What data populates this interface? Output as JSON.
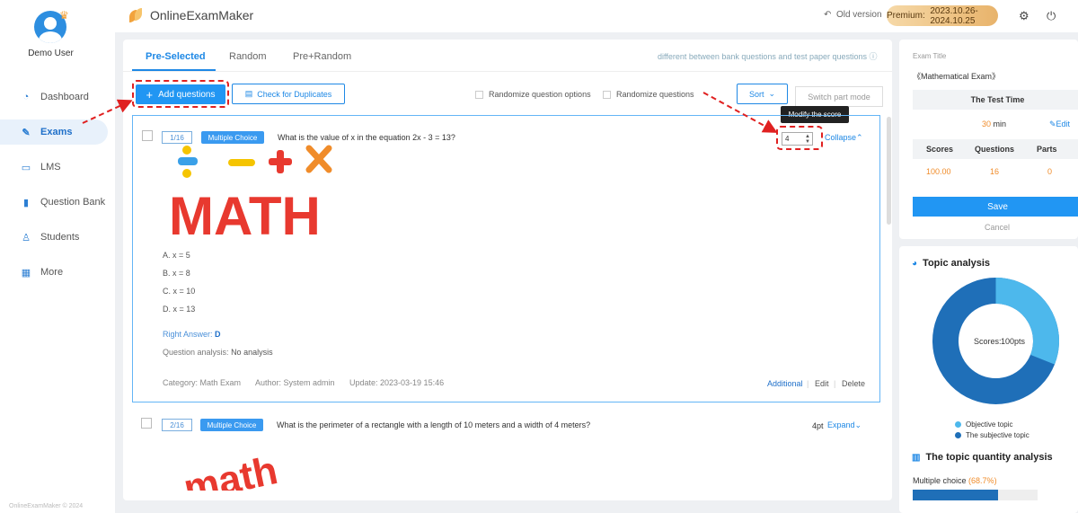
{
  "sidebar": {
    "username": "Demo User",
    "items": [
      {
        "label": "Dashboard",
        "icon": "dashboard-icon"
      },
      {
        "label": "Exams",
        "icon": "pencil-icon"
      },
      {
        "label": "LMS",
        "icon": "book-icon"
      },
      {
        "label": "Question Bank",
        "icon": "chart-bars-icon"
      },
      {
        "label": "Students",
        "icon": "person-icon"
      },
      {
        "label": "More",
        "icon": "grid-icon"
      }
    ],
    "copyright": "OnlineExamMaker © 2024"
  },
  "topbar": {
    "brand": "OnlineExamMaker",
    "old_version": "Old version",
    "premium_label": "Premium:",
    "premium_dates": "2023.10.26-2024.10.25"
  },
  "tabs": {
    "pre_selected": "Pre-Selected",
    "random": "Random",
    "pre_random": "Pre+Random",
    "note": "different between bank questions and test paper questions"
  },
  "toolbar": {
    "add_questions": "Add questions",
    "check_duplicates": "Check for Duplicates",
    "randomize_options": "Randomize question options",
    "randomize_questions": "Randomize questions",
    "sort": "Sort",
    "switch_part": "Switch part mode",
    "tooltip": "Modify the score"
  },
  "question1": {
    "number": "1/16",
    "type": "Multiple Choice",
    "text": "What is the value of x in the equation 2x - 3 = 13?",
    "score": "4",
    "collapse": "Collapse",
    "image_text": "MATH",
    "options": [
      "A. x = 5",
      "B. x = 8",
      "C. x = 10",
      "D. x = 13"
    ],
    "right_answer_label": "Right Answer:",
    "right_answer": "D",
    "analysis_label": "Question analysis:",
    "analysis": "No analysis",
    "category": "Category: Math Exam",
    "author": "Author: System admin",
    "update": "Update: 2023-03-19 15:46",
    "additional": "Additional",
    "edit": "Edit",
    "delete": "Delete"
  },
  "question2": {
    "number": "2/16",
    "type": "Multiple Choice",
    "text": "What is the perimeter of a rectangle with a length of 10 meters and a width of 4 meters?",
    "score": "4pt",
    "expand": "Expand",
    "image_text": "math"
  },
  "exam_info": {
    "title_label": "Exam Title",
    "title": "《Mathematical Exam》",
    "test_time_label": "The Test Time",
    "time_value": "30",
    "time_unit": "min",
    "edit": "Edit",
    "headers": [
      "Scores",
      "Questions",
      "Parts"
    ],
    "values": [
      "100.00",
      "16",
      "0"
    ],
    "save": "Save",
    "cancel": "Cancel"
  },
  "topic_analysis": {
    "title": "Topic analysis",
    "center_label": "Scores:",
    "center_value": "100pts",
    "legend": [
      "Objective topic",
      "The subjective topic"
    ],
    "colors": [
      "#4db8ec",
      "#1f6fb8"
    ],
    "objective_fraction": 0.31
  },
  "quantity_analysis": {
    "title": "The topic quantity analysis",
    "label": "Multiple choice",
    "percent": "(68.7%)",
    "fraction": 0.687
  }
}
